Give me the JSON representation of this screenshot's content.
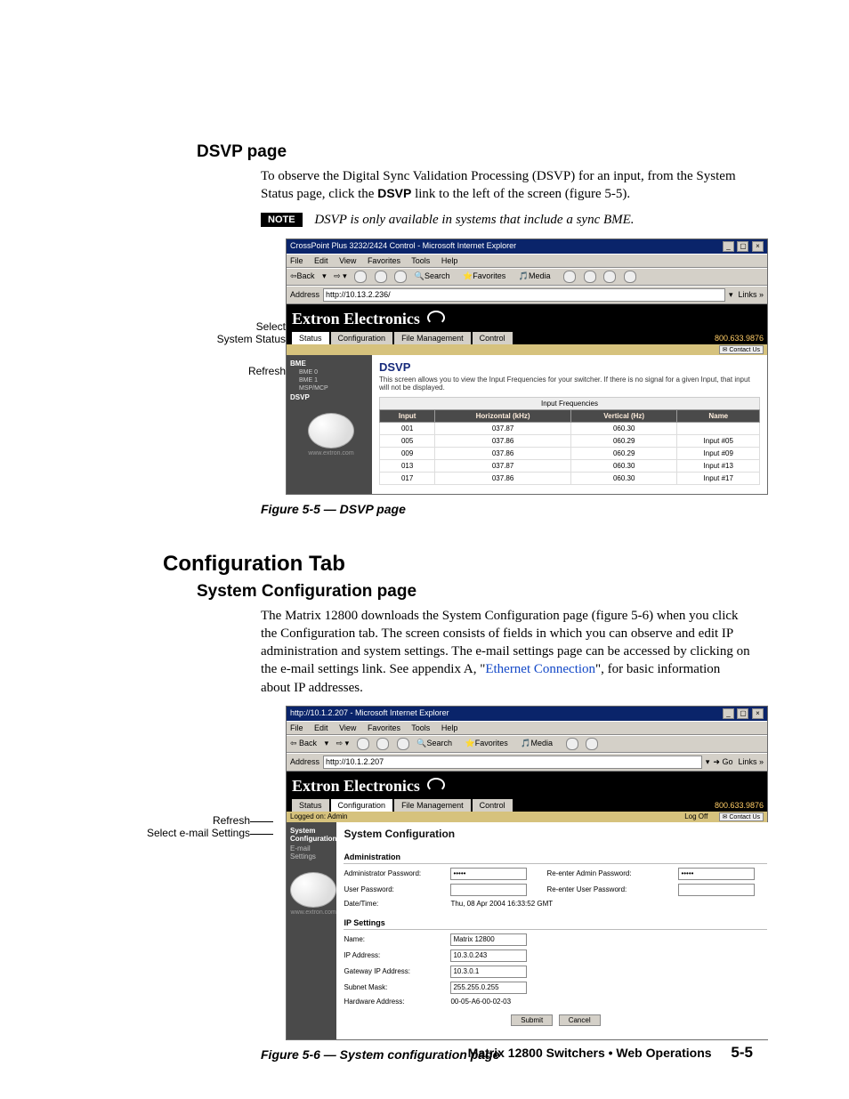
{
  "section1": {
    "heading": "DSVP page",
    "para": "To observe the Digital Sync Validation Processing (DSVP) for an input, from the System Status page, click the ",
    "para_bold": "DSVP",
    "para_tail": " link to the left of the screen (figure 5-5).",
    "note_label": "NOTE",
    "note_text": "DSVP is only available in systems that include a sync BME."
  },
  "fig55_caption": "Figure 5-5 — DSVP page",
  "fig55_callouts": {
    "a": "Select",
    "b": "System Status",
    "c": "Refresh"
  },
  "browser1": {
    "title": "CrossPoint Plus 3232/2424 Control - Microsoft Internet Explorer",
    "menu": [
      "File",
      "Edit",
      "View",
      "Favorites",
      "Tools",
      "Help"
    ],
    "toolbar": [
      "Back",
      "Search",
      "Favorites",
      "Media"
    ],
    "addr_label": "Address",
    "addr_value": "http://10.13.2.236/",
    "links_label": "Links",
    "brand": "Extron Electronics",
    "tabs": [
      "Status",
      "Configuration",
      "File Management",
      "Control"
    ],
    "phone": "800.633.9876",
    "contact": "Contact Us",
    "sidenav": {
      "top": "BME",
      "items": [
        "BME 0",
        "BME 1",
        "MSP/MCP"
      ],
      "dsvp": "DSVP",
      "url": "www.extron.com"
    },
    "dsvp_heading": "DSVP",
    "dsvp_desc": "This screen allows you to view the Input Frequencies for your switcher. If there is no signal for a given Input, that input will not be displayed.",
    "freq_header": "Input Frequencies",
    "cols": [
      "Input",
      "Horizontal (kHz)",
      "Vertical (Hz)",
      "Name"
    ],
    "rows": [
      {
        "input": "001",
        "h": "037.87",
        "v": "060.30",
        "name": ""
      },
      {
        "input": "005",
        "h": "037.86",
        "v": "060.29",
        "name": "Input #05"
      },
      {
        "input": "009",
        "h": "037.86",
        "v": "060.29",
        "name": "Input #09"
      },
      {
        "input": "013",
        "h": "037.87",
        "v": "060.30",
        "name": "Input #13"
      },
      {
        "input": "017",
        "h": "037.86",
        "v": "060.30",
        "name": "Input #17"
      }
    ]
  },
  "tab_heading": "Configuration Tab",
  "section2": {
    "heading": "System Configuration page",
    "para_a": "The Matrix 12800 downloads the System Configuration page (figure 5-6) when you click the Configuration tab.  The screen consists of fields in which you can observe and edit IP administration and system settings.  The e-mail settings page can be accessed by clicking on the e-mail settings link.  See appendix A, \"",
    "link": "Ethernet Connection",
    "para_b": "\", for basic information about IP addresses."
  },
  "fig56_caption": "Figure 5-6 — System configuration page",
  "fig56_callouts": {
    "a": "Refresh",
    "b": "Select e-mail Settings"
  },
  "browser2": {
    "title": "http://10.1.2.207 - Microsoft Internet Explorer",
    "menu": [
      "File",
      "Edit",
      "View",
      "Favorites",
      "Tools",
      "Help"
    ],
    "toolbar": [
      "Back",
      "Search",
      "Favorites",
      "Media"
    ],
    "addr_label": "Address",
    "addr_value": "http://10.1.2.207",
    "go_label": "Go",
    "links_label": "Links",
    "brand": "Extron Electronics",
    "tabs": [
      "Status",
      "Configuration",
      "File Management",
      "Control"
    ],
    "phone": "800.633.9876",
    "loggedon": "Logged on: Admin",
    "logoff": "Log Off",
    "contact": "Contact Us",
    "sidenav": {
      "items": [
        "System Configuration",
        "E-mail Settings"
      ],
      "url": "www.extron.com"
    },
    "cfg_title": "System Configuration",
    "admin_hdr": "Administration",
    "admin_pw_lbl": "Administrator Password:",
    "admin_pw_val": "•••••",
    "admin_pw2_lbl": "Re-enter Admin Password:",
    "admin_pw2_val": "•••••",
    "user_pw_lbl": "User Password:",
    "user_pw2_lbl": "Re-enter User Password:",
    "datetime_lbl": "Date/Time:",
    "datetime_val": "Thu, 08 Apr 2004 16:33:52 GMT",
    "ip_hdr": "IP Settings",
    "name_lbl": "Name:",
    "name_val": "Matrix 12800",
    "ip_lbl": "IP Address:",
    "ip_val": "10.3.0.243",
    "gw_lbl": "Gateway IP Address:",
    "gw_val": "10.3.0.1",
    "sn_lbl": "Subnet Mask:",
    "sn_val": "255.255.0.255",
    "hw_lbl": "Hardware Address:",
    "hw_val": "00-05-A6-00-02-03",
    "submit": "Submit",
    "cancel": "Cancel"
  },
  "footer": {
    "text": "Matrix 12800 Switchers • Web Operations",
    "page": "5-5"
  }
}
